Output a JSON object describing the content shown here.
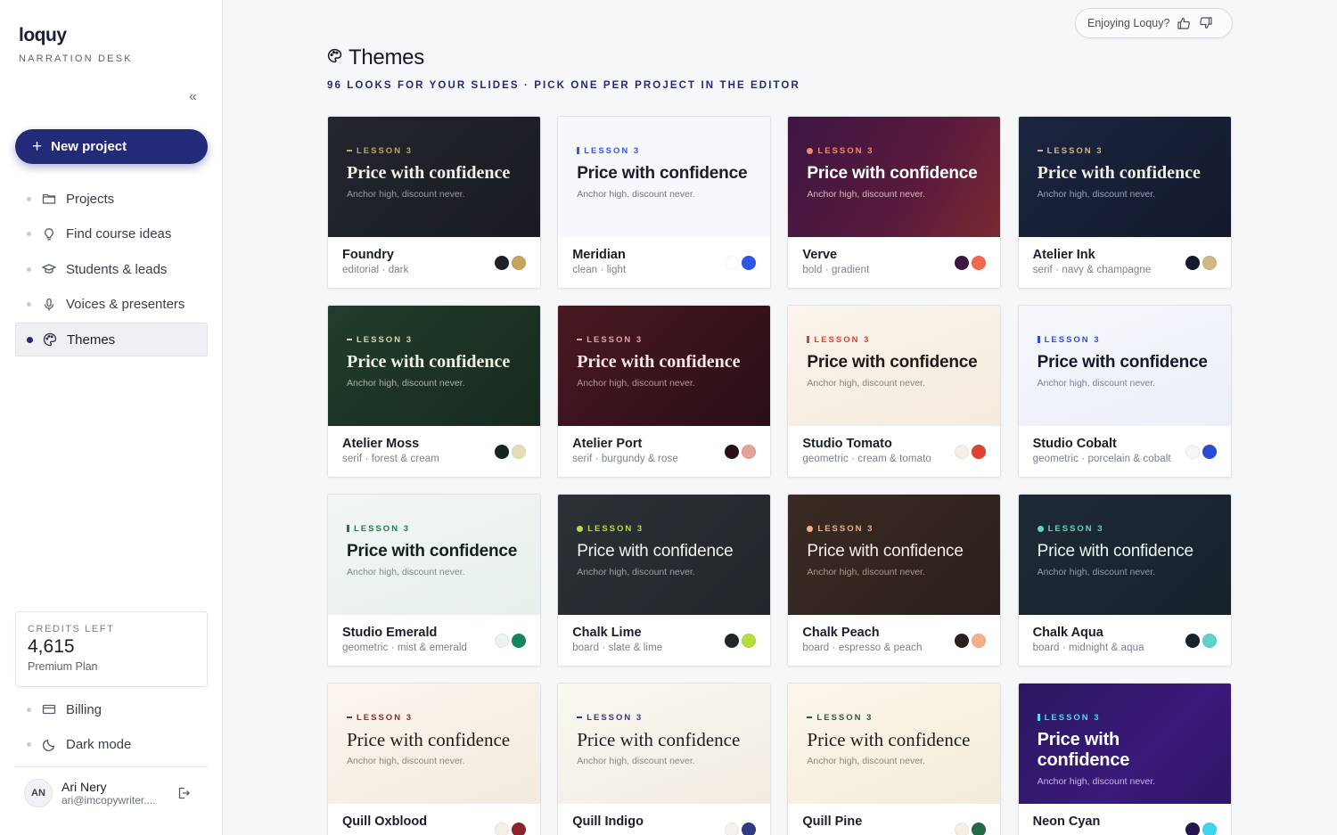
{
  "sidebar": {
    "brand": "loquy",
    "brand_sub": "NARRATION DESK",
    "collapse": "«",
    "new_project": "New project",
    "items": [
      {
        "label": "Projects",
        "icon": "folder-icon"
      },
      {
        "label": "Find course ideas",
        "icon": "lightbulb-icon"
      },
      {
        "label": "Students & leads",
        "icon": "graduation-cap-icon"
      },
      {
        "label": "Voices & presenters",
        "icon": "microphone-icon"
      },
      {
        "label": "Themes",
        "icon": "palette-icon",
        "active": true
      }
    ],
    "credits": {
      "label": "CREDITS LEFT",
      "value": "4,615",
      "plan": "Premium Plan"
    },
    "bottom_items": [
      {
        "label": "Billing",
        "icon": "credit-card-icon"
      },
      {
        "label": "Dark mode",
        "icon": "moon-icon"
      }
    ],
    "user": {
      "initials": "AN",
      "name": "Ari Nery",
      "email": "ari@imcopywriter...."
    }
  },
  "header": {
    "feedback_label": "Enjoying Loquy?",
    "title": "Themes",
    "subtitle": "96 LOOKS FOR YOUR SLIDES · PICK ONE PER PROJECT IN THE EDITOR"
  },
  "preview_text": {
    "kicker": "LESSON 3",
    "title": "Price with confidence",
    "subtitle": "Anchor high, discount never."
  },
  "themes": [
    {
      "name": "Foundry",
      "desc": "editorial · dark",
      "bg": "linear-gradient(135deg,#23262e,#1a1c22)",
      "kicker_color": "#c8a35a",
      "mark": "dash",
      "title_color": "#f4f1ea",
      "sub_color": "#9a9ca3",
      "font": "serif",
      "swatches": [
        "#1f2228",
        "#c8a35a"
      ]
    },
    {
      "name": "Meridian",
      "desc": "clean · light",
      "bg": "#f7f8fb",
      "kicker_color": "#3a59e0",
      "mark": "bar",
      "title_color": "#1a1e2c",
      "sub_color": "#70757f",
      "font": "sans",
      "swatches": [
        "#ffffff",
        "#2f55e8"
      ]
    },
    {
      "name": "Verve",
      "desc": "bold · gradient",
      "bg": "linear-gradient(120deg,#3e1543,#5a1a3c 60%,#7a2a30)",
      "kicker_color": "#f08a6e",
      "mark": "dot",
      "title_color": "#ffffff",
      "sub_color": "#d6b6c2",
      "font": "sans",
      "swatches": [
        "#3e1543",
        "#f26a4b"
      ]
    },
    {
      "name": "Atelier Ink",
      "desc": "serif · navy & champagne",
      "bg": "linear-gradient(135deg,#1b2540,#141a2c)",
      "kicker_color": "#d1b786",
      "mark": "dash",
      "title_color": "#f3eee3",
      "sub_color": "#9aa0b3",
      "font": "serif",
      "swatches": [
        "#141b2e",
        "#d1b786"
      ]
    },
    {
      "name": "Atelier Moss",
      "desc": "serif · forest & cream",
      "bg": "linear-gradient(135deg,#213d2c,#172a1f)",
      "kicker_color": "#e2d6b0",
      "mark": "dash",
      "title_color": "#f3efe2",
      "sub_color": "#a7b3a8",
      "font": "serif",
      "swatches": [
        "#16271d",
        "#e8dcb6"
      ]
    },
    {
      "name": "Atelier Port",
      "desc": "serif · burgundy & rose",
      "bg": "linear-gradient(135deg,#4a1823,#2a0f16)",
      "kicker_color": "#e2a9a0",
      "mark": "dash",
      "title_color": "#f5e8e6",
      "sub_color": "#b79698",
      "font": "serif",
      "swatches": [
        "#2b0f17",
        "#e2a39a"
      ]
    },
    {
      "name": "Studio Tomato",
      "desc": "geometric · cream & tomato",
      "bg": "linear-gradient(160deg,#fbf4ec,#f5ebdd)",
      "kicker_color": "#d8452f",
      "mark": "bar",
      "title_color": "#1e1a18",
      "sub_color": "#8a8279",
      "font": "sans",
      "swatches": [
        "#f7efe6",
        "#e0442e"
      ]
    },
    {
      "name": "Studio Cobalt",
      "desc": "geometric · porcelain & cobalt",
      "bg": "linear-gradient(160deg,#f5f7fb,#ebeff7)",
      "kicker_color": "#2f4fd0",
      "mark": "bar",
      "title_color": "#14182a",
      "sub_color": "#7c8292",
      "font": "sans",
      "swatches": [
        "#f4f6fa",
        "#2a4bd8"
      ]
    },
    {
      "name": "Studio Emerald",
      "desc": "geometric · mist & emerald",
      "bg": "linear-gradient(160deg,#f1f6f3,#e8f0eb)",
      "kicker_color": "#1d7a4c",
      "mark": "bar",
      "title_color": "#14201a",
      "sub_color": "#7d8a82",
      "font": "sans",
      "swatches": [
        "#edf3ef",
        "#15875a"
      ]
    },
    {
      "name": "Chalk Lime",
      "desc": "board · slate & lime",
      "bg": "linear-gradient(135deg,#2c3136,#22262b)",
      "kicker_color": "#b7dc4a",
      "mark": "dot",
      "title_color": "#f2f4f0",
      "sub_color": "#9aa0a4",
      "font": "sans-light",
      "swatches": [
        "#23272c",
        "#b3de3e"
      ]
    },
    {
      "name": "Chalk Peach",
      "desc": "board · espresso & peach",
      "bg": "linear-gradient(135deg,#3a2b24,#2a1f1a)",
      "kicker_color": "#f0b08a",
      "mark": "dot",
      "title_color": "#f6eee8",
      "sub_color": "#a8988e",
      "font": "sans-light",
      "swatches": [
        "#2b201b",
        "#f2b08c"
      ]
    },
    {
      "name": "Chalk Aqua",
      "desc": "board · midnight & aqua",
      "bg": "linear-gradient(135deg,#1d2a35,#17222b)",
      "kicker_color": "#62d3c9",
      "mark": "dot",
      "title_color": "#eef5f6",
      "sub_color": "#8f9ca5",
      "font": "sans-light",
      "swatches": [
        "#17222b",
        "#5fd3cb"
      ]
    },
    {
      "name": "Quill Oxblood",
      "desc": "",
      "bg": "linear-gradient(160deg,#faf5ee,#f3ebdf)",
      "kicker_color": "#8a2a2a",
      "mark": "dash",
      "title_color": "#221a17",
      "sub_color": "#8f857b",
      "font": "serif-light",
      "swatches": [
        "#f6efe6",
        "#8c2430"
      ]
    },
    {
      "name": "Quill Indigo",
      "desc": "",
      "bg": "linear-gradient(160deg,#faf7f1,#f2ece2)",
      "kicker_color": "#2f3a7a",
      "mark": "dash",
      "title_color": "#1b1c24",
      "sub_color": "#8c877f",
      "font": "serif-light",
      "swatches": [
        "#f6f1ea",
        "#2e3a86"
      ]
    },
    {
      "name": "Quill Pine",
      "desc": "",
      "bg": "linear-gradient(160deg,#fbf6ea,#f4ecd9)",
      "kicker_color": "#2c5a40",
      "mark": "dash",
      "title_color": "#1d1f1a",
      "sub_color": "#8d877a",
      "font": "serif-light",
      "swatches": [
        "#f6f0e2",
        "#1f6b45"
      ]
    },
    {
      "name": "Neon Cyan",
      "desc": "",
      "bg": "linear-gradient(135deg,#2a1760,#3a1a7a 60%,#2d1566)",
      "kicker_color": "#4fd8f0",
      "mark": "bar",
      "title_color": "#ffffff",
      "sub_color": "#c3b6e6",
      "font": "sans-heavy",
      "swatches": [
        "#241452",
        "#3ad6f2"
      ]
    }
  ]
}
